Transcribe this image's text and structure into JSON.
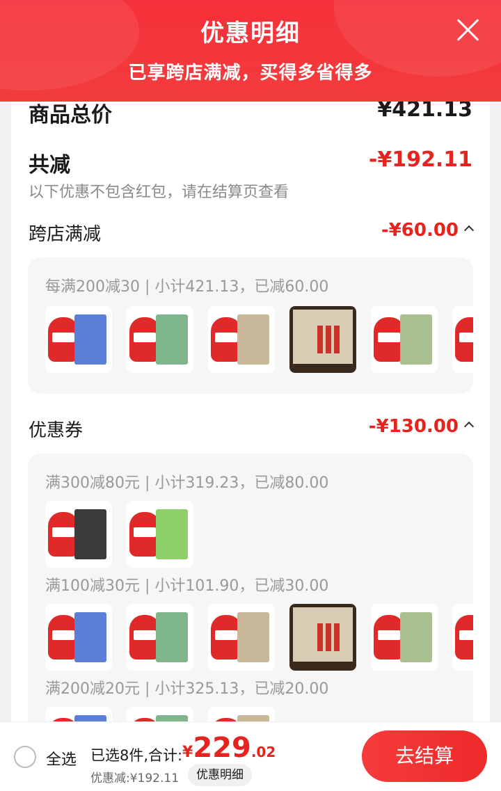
{
  "header": {
    "title": "优惠明细",
    "subtitle": "已享跨店满减，买得多省得多"
  },
  "summary": {
    "total_label": "商品总价",
    "total_value": "¥421.13",
    "reduce_label": "共减",
    "reduce_value": "-¥192.11",
    "hint": "以下优惠不包含红包，请在结算页查看"
  },
  "cross_store": {
    "title": "跨店满减",
    "value": "-¥60.00",
    "rule": "每满200减30 | 小计421.13，已减60.00"
  },
  "coupons": {
    "title": "优惠券",
    "value": "-¥130.00",
    "groups": [
      {
        "rule": "满300减80元 | 小计319.23，已减80.00"
      },
      {
        "rule": "满100减30元 | 小计101.90，已减30.00"
      },
      {
        "rule": "满200减20元 | 小计325.13，已减20.00"
      }
    ]
  },
  "bottom": {
    "select_all": "全选",
    "selected_text": "已选8件,合计:",
    "price_symbol": "¥",
    "price_int": "229",
    "price_dec": ".02",
    "discount_text": "优惠减:¥192.11",
    "detail_button": "优惠明细",
    "checkout_button": "去结算"
  },
  "colors": {
    "brand_red": "#f23c3c",
    "price_red": "#e5231f"
  }
}
